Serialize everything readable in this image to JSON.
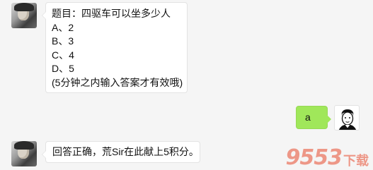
{
  "messages": [
    {
      "sender": "bot",
      "lines": [
        "题目：四驱车可以坐多少人",
        "A、2",
        "B、3",
        "C、4",
        "D、5",
        "(5分钟之内输入答案才有效哦)"
      ]
    },
    {
      "sender": "user",
      "text": "a"
    },
    {
      "sender": "bot",
      "text": "回答正确，荒Sir在此献上5积分。"
    }
  ],
  "watermark": {
    "numbers": "9553",
    "text": "下载"
  },
  "colors": {
    "background": "#f5f5f5",
    "bot_bubble": "#ffffff",
    "user_bubble": "#a0e75a"
  }
}
